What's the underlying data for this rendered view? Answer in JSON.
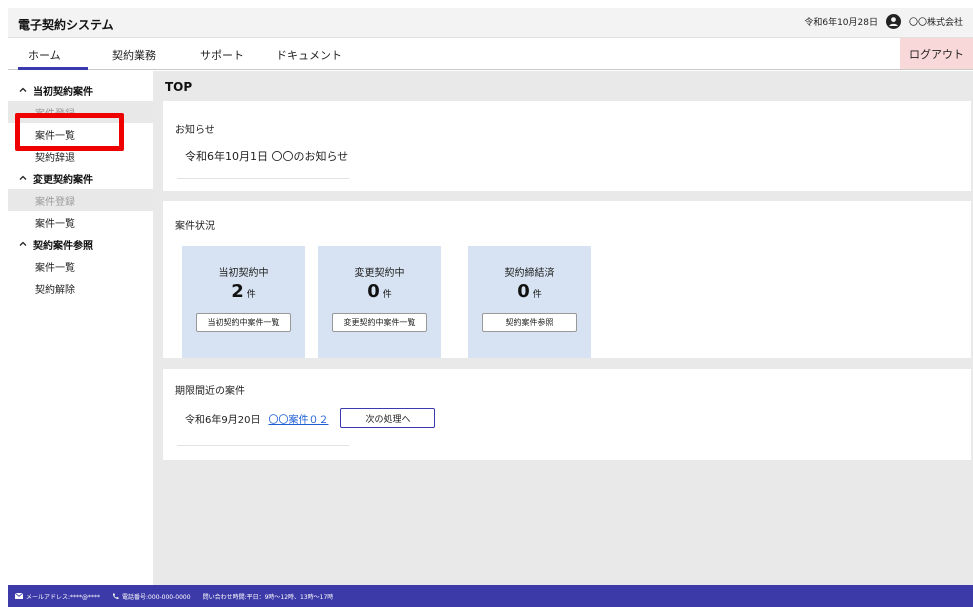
{
  "header": {
    "app_title": "電子契約システム",
    "date": "令和6年10月28日",
    "company": "〇〇株式会社"
  },
  "menu": {
    "items": [
      "ホーム",
      "契約業務",
      "サポート",
      "ドキュメント"
    ],
    "logout": "ログアウト"
  },
  "sidebar": {
    "sections": [
      {
        "label": "当初契約案件",
        "items": [
          {
            "label": "案件登録",
            "disabled": true
          },
          {
            "label": "案件一覧",
            "disabled": false
          },
          {
            "label": "契約辞退",
            "disabled": false
          }
        ]
      },
      {
        "label": "変更契約案件",
        "items": [
          {
            "label": "案件登録",
            "disabled": true
          },
          {
            "label": "案件一覧",
            "disabled": false
          }
        ]
      },
      {
        "label": "契約案件参照",
        "items": [
          {
            "label": "案件一覧",
            "disabled": false
          },
          {
            "label": "契約解除",
            "disabled": false
          }
        ]
      }
    ]
  },
  "main": {
    "page_title": "TOP",
    "news": {
      "title": "お知らせ",
      "items": [
        "令和6年10月1日 〇〇のお知らせ"
      ]
    },
    "status": {
      "title": "案件状況",
      "boxes": [
        {
          "label": "当初契約中",
          "count": "2",
          "unit": "件",
          "button": "当初契約中案件一覧"
        },
        {
          "label": "変更契約中",
          "count": "0",
          "unit": "件",
          "button": "変更契約中案件一覧"
        },
        {
          "label": "契約締結済",
          "count": "0",
          "unit": "件",
          "button": "契約案件参照"
        }
      ]
    },
    "deadline": {
      "title": "期限間近の案件",
      "date": "令和6年9月20日",
      "link": "〇〇案件０２",
      "button": "次の処理へ"
    }
  },
  "footer": {
    "email": "メールアドレス:****@****",
    "phone": "電話番号:000-000-0000",
    "hours": "問い合わせ時間:平日：9時〜12時、13時〜17時"
  },
  "colors": {
    "accent": "#3c3aa8",
    "logout_bg": "#f8d8d8",
    "stat_box_bg": "#d7e3f2",
    "highlight": "#ee0000",
    "link": "#1f5fd6"
  }
}
